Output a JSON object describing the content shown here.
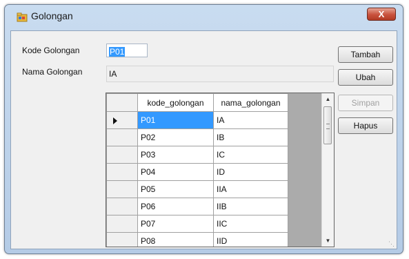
{
  "window": {
    "title": "Golongan",
    "close_label": "X"
  },
  "form": {
    "kode_label": "Kode Golongan",
    "kode_value": "P01",
    "nama_label": "Nama Golongan",
    "nama_value": "IA"
  },
  "buttons": {
    "tambah": "Tambah",
    "ubah": "Ubah",
    "simpan": "Simpan",
    "hapus": "Hapus"
  },
  "grid": {
    "columns": [
      "kode_golongan",
      "nama_golongan"
    ],
    "rows": [
      [
        "P01",
        "IA"
      ],
      [
        "P02",
        "IB"
      ],
      [
        "P03",
        "IC"
      ],
      [
        "P04",
        "ID"
      ],
      [
        "P05",
        "IIA"
      ],
      [
        "P06",
        "IIB"
      ],
      [
        "P07",
        "IIC"
      ],
      [
        "P08",
        "IID"
      ]
    ],
    "selected_row": 0
  },
  "icons": {
    "app": "folder-icon",
    "row_pointer": "row-pointer-icon"
  },
  "colors": {
    "selection": "#3399ff",
    "close": "#c8513c"
  }
}
